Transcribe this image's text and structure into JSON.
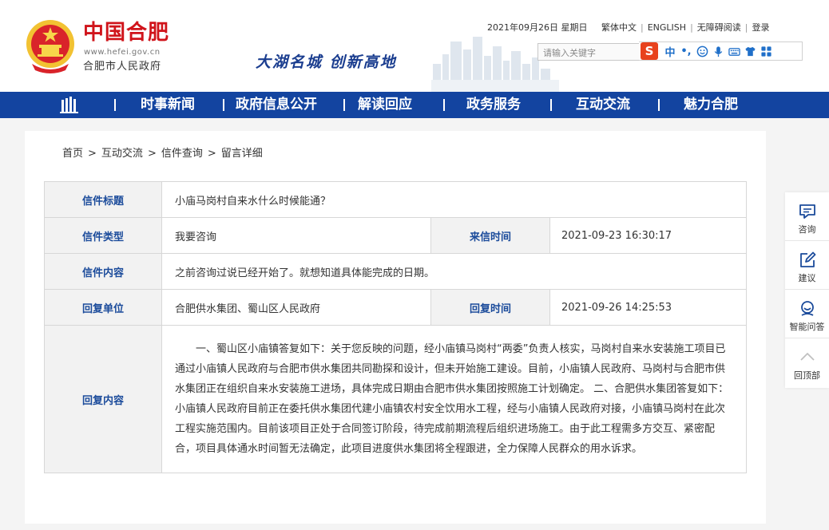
{
  "header": {
    "logo_title": "中国合肥",
    "logo_url": "www.hefei.gov.cn",
    "logo_subtitle": "合肥市人民政府",
    "slogan": "大湖名城 创新高地",
    "date": "2021年09月26日 星期日",
    "links": [
      "繁体中文",
      "ENGLISH",
      "无障碍阅读",
      "登录"
    ],
    "search_placeholder": "请输入关键字",
    "toolbar_badge": "S",
    "toolbar_zh": "中",
    "toolbar_punct": "•,"
  },
  "nav": {
    "items": [
      "时事新闻",
      "政府信息公开",
      "解读回应",
      "政务服务",
      "互动交流",
      "魅力合肥"
    ]
  },
  "breadcrumb": {
    "items": [
      "首页",
      "互动交流",
      "信件查询",
      "留言详细"
    ],
    "separator": ">"
  },
  "letter": {
    "title_label": "信件标题",
    "title": "小庙马岗村自来水什么时候能通？",
    "type_label": "信件类型",
    "type": "我要咨询",
    "sent_time_label": "来信时间",
    "sent_time": "2021-09-23 16:30:17",
    "content_label": "信件内容",
    "content": "之前咨询过说已经开始了。就想知道具体能完成的日期。",
    "reply_unit_label": "回复单位",
    "reply_unit": "合肥供水集团、蜀山区人民政府",
    "reply_time_label": "回复时间",
    "reply_time": "2021-09-26 14:25:53",
    "reply_content_label": "回复内容",
    "reply_content": "一、蜀山区小庙镇答复如下：关于您反映的问题，经小庙镇马岗村“两委”负责人核实，马岗村自来水安装施工项目已通过小庙镇人民政府与合肥市供水集团共同勘探和设计，但未开始施工建设。目前，小庙镇人民政府、马岗村与合肥市供水集团正在组织自来水安装施工进场，具体完成日期由合肥市供水集团按照施工计划确定。 二、合肥供水集团答复如下：小庙镇人民政府目前正在委托供水集团代建小庙镇农村安全饮用水工程，经与小庙镇人民政府对接，小庙镇马岗村在此次工程实施范围内。目前该项目正处于合同签订阶段，待完成前期流程后组织进场施工。由于此工程需多方交互、紧密配合，项目具体通水时间暂无法确定，此项目进度供水集团将全程跟进，全力保障人民群众的用水诉求。"
  },
  "sidebar": {
    "items": [
      "咨询",
      "建议",
      "智能问答",
      "回顶部"
    ]
  },
  "colors": {
    "nav_bg": "#1344a0",
    "logo_red": "#d0141b",
    "label_blue": "#1b4b9b",
    "sogou_orange": "#e8421d"
  },
  "icons": {
    "toolbar": [
      "sogou-icon",
      "microphone-icon",
      "smiley-icon",
      "keyboard-icon",
      "shirt-icon",
      "grid-icon"
    ],
    "sidebar": [
      "chat-icon",
      "edit-icon",
      "robot-icon",
      "arrow-up-icon"
    ]
  }
}
